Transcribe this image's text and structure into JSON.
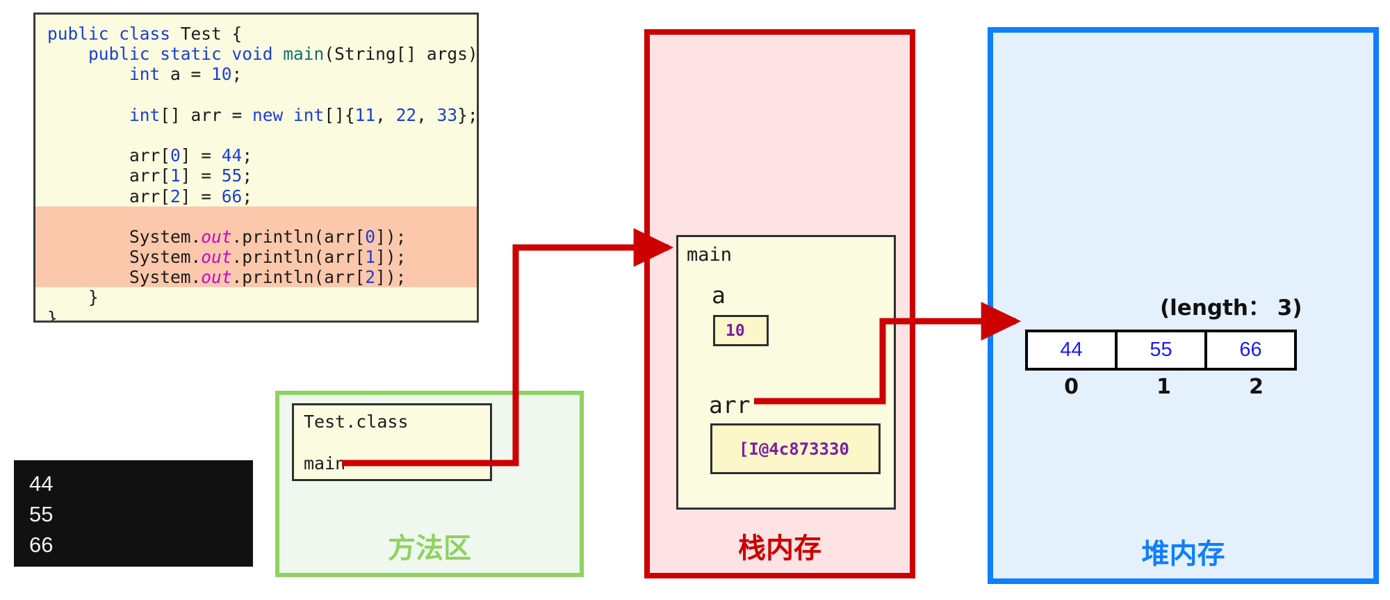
{
  "code": {
    "lines": [
      [
        {
          "t": "public ",
          "c": "kw"
        },
        {
          "t": "class ",
          "c": "kw"
        },
        {
          "t": "Test {",
          "c": "pl"
        }
      ],
      [
        {
          "t": "    public ",
          "c": "kw"
        },
        {
          "t": "static ",
          "c": "kw"
        },
        {
          "t": "void ",
          "c": "kw"
        },
        {
          "t": "main",
          "c": "meth"
        },
        {
          "t": "(String[] args) {",
          "c": "pl"
        }
      ],
      [
        {
          "t": "        int ",
          "c": "kw"
        },
        {
          "t": "a = ",
          "c": "pl"
        },
        {
          "t": "10",
          "c": "num"
        },
        {
          "t": ";",
          "c": "pl"
        }
      ],
      [
        {
          "t": "",
          "c": "pl"
        }
      ],
      [
        {
          "t": "        int",
          "c": "kw"
        },
        {
          "t": "[] arr = ",
          "c": "pl"
        },
        {
          "t": "new ",
          "c": "kw"
        },
        {
          "t": "int",
          "c": "kw"
        },
        {
          "t": "[]{",
          "c": "pl"
        },
        {
          "t": "11",
          "c": "num"
        },
        {
          "t": ", ",
          "c": "pl"
        },
        {
          "t": "22",
          "c": "num"
        },
        {
          "t": ", ",
          "c": "pl"
        },
        {
          "t": "33",
          "c": "num"
        },
        {
          "t": "};",
          "c": "pl"
        }
      ],
      [
        {
          "t": "",
          "c": "pl"
        }
      ],
      [
        {
          "t": "        arr[",
          "c": "pl"
        },
        {
          "t": "0",
          "c": "num"
        },
        {
          "t": "] = ",
          "c": "pl"
        },
        {
          "t": "44",
          "c": "num"
        },
        {
          "t": ";",
          "c": "pl"
        }
      ],
      [
        {
          "t": "        arr[",
          "c": "pl"
        },
        {
          "t": "1",
          "c": "num"
        },
        {
          "t": "] = ",
          "c": "pl"
        },
        {
          "t": "55",
          "c": "num"
        },
        {
          "t": ";",
          "c": "pl"
        }
      ],
      [
        {
          "t": "        arr[",
          "c": "pl"
        },
        {
          "t": "2",
          "c": "num"
        },
        {
          "t": "] = ",
          "c": "pl"
        },
        {
          "t": "66",
          "c": "num"
        },
        {
          "t": ";",
          "c": "pl"
        }
      ],
      [
        {
          "t": "",
          "c": "pl"
        }
      ],
      [
        {
          "t": "        System.",
          "c": "pl"
        },
        {
          "t": "out",
          "c": "field"
        },
        {
          "t": ".println(arr[",
          "c": "pl"
        },
        {
          "t": "0",
          "c": "num"
        },
        {
          "t": "]);",
          "c": "pl"
        }
      ],
      [
        {
          "t": "        System.",
          "c": "pl"
        },
        {
          "t": "out",
          "c": "field"
        },
        {
          "t": ".println(arr[",
          "c": "pl"
        },
        {
          "t": "1",
          "c": "num"
        },
        {
          "t": "]);",
          "c": "pl"
        }
      ],
      [
        {
          "t": "        System.",
          "c": "pl"
        },
        {
          "t": "out",
          "c": "field"
        },
        {
          "t": ".println(arr[",
          "c": "pl"
        },
        {
          "t": "2",
          "c": "num"
        },
        {
          "t": "]);",
          "c": "pl"
        }
      ],
      [
        {
          "t": "    }",
          "c": "pl"
        }
      ],
      [
        {
          "t": "}",
          "c": "pl"
        }
      ]
    ],
    "highlighted_lines": [
      9,
      10,
      11,
      12
    ],
    "background": "#FBFBE0",
    "highlight_color": "#FBC8AC"
  },
  "console": {
    "lines": [
      "44",
      "55",
      "66"
    ],
    "background": "#111111",
    "text_color": "#f2f2f2"
  },
  "method_area": {
    "label": "方法区",
    "accent": "#8ED260",
    "class_box": {
      "class_name": "Test.class",
      "method_name": "main"
    }
  },
  "stack_area": {
    "label": "栈内存",
    "accent": "#CC0000",
    "frame": {
      "title": "main",
      "variables": [
        {
          "name": "a",
          "value": "10"
        },
        {
          "name": "arr",
          "value": "[I@4c873330"
        }
      ]
    }
  },
  "heap_area": {
    "label": "堆内存",
    "accent": "#0D7FFF",
    "array": {
      "length_label": "(length： 3)",
      "values": [
        "44",
        "55",
        "66"
      ],
      "indices": [
        "0",
        "1",
        "2"
      ]
    }
  },
  "arrows": {
    "color": "#CC0000",
    "items": [
      {
        "name": "method-main-to-stack-main",
        "from": "method_area.main",
        "to": "stack_area.frame.title"
      },
      {
        "name": "stack-arr-to-heap-array",
        "from": "stack_area.frame.arr",
        "to": "heap_area.array.cell0"
      }
    ]
  }
}
